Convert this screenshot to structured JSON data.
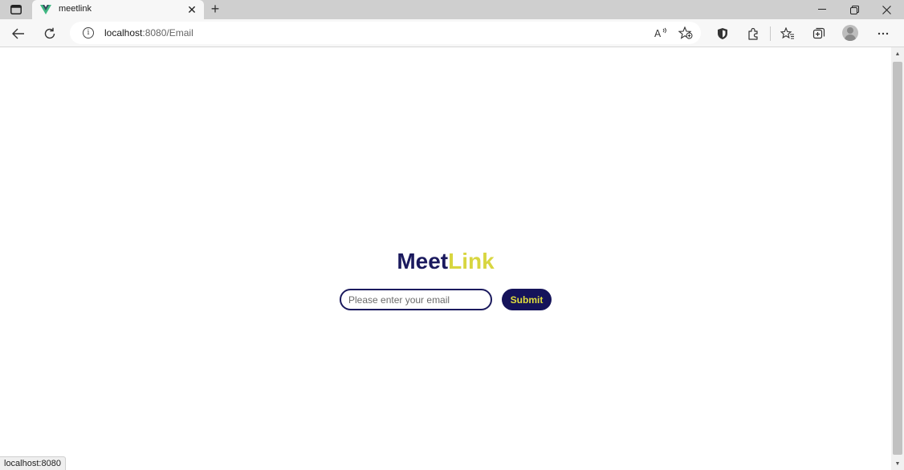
{
  "browser": {
    "tab": {
      "title": "meetlink",
      "favicon": "vue-logo-icon"
    },
    "new_tab_label": "+",
    "address_bar": {
      "host": "localhost",
      "rest": ":8080/Email"
    },
    "status_text": "localhost:8080"
  },
  "page": {
    "brand": {
      "part1": "Meet",
      "part2": "Link"
    },
    "email_input": {
      "placeholder": "Please enter your email",
      "value": ""
    },
    "submit_label": "Submit"
  },
  "colors": {
    "brand_navy": "#1b1a5e",
    "brand_yellow": "#d8d640",
    "button_bg": "#15135a",
    "button_text": "#e2df3c"
  }
}
